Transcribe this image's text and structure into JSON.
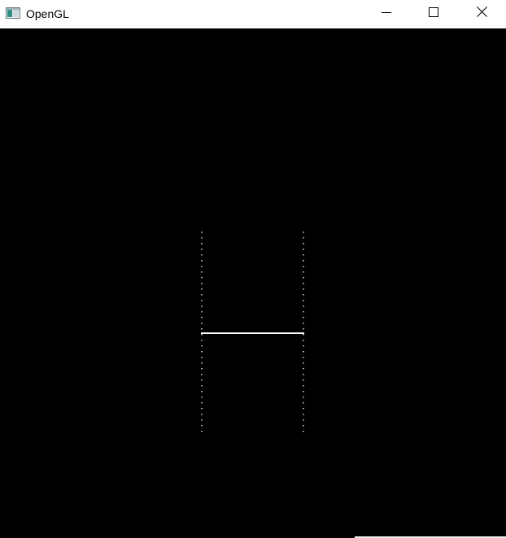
{
  "window": {
    "title": "OpenGL",
    "icon": "opengl-window-icon"
  },
  "caption_buttons": {
    "minimize": "minimize-icon",
    "maximize": "maximize-icon",
    "close": "close-icon"
  },
  "canvas": {
    "background": "#000000",
    "line_color": "#ffffff"
  }
}
